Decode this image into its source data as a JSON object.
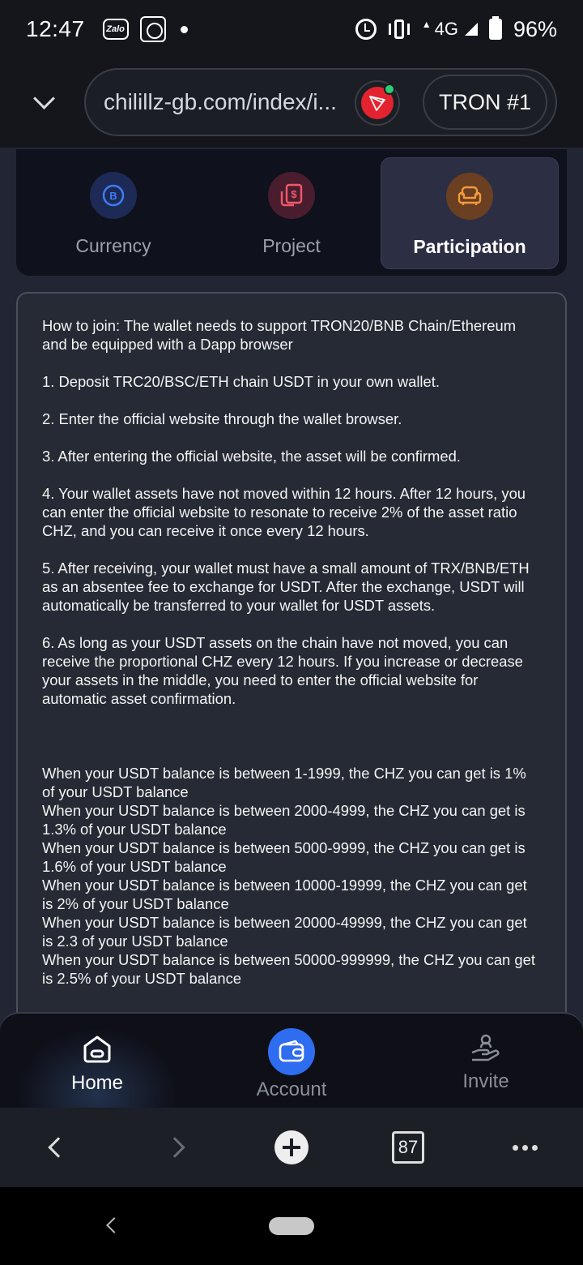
{
  "status_bar": {
    "time": "12:47",
    "app_icons": [
      "zalo-icon",
      "app-notification-icon"
    ],
    "zalo_label": "Zalo",
    "network": "4G",
    "battery": "96%"
  },
  "browser": {
    "url": "chilillz-gb.com/index/i...",
    "network_button": "TRON #1",
    "tab_count": "87"
  },
  "tabs": [
    {
      "label": "Currency",
      "icon": "bitcoin-icon",
      "active": false
    },
    {
      "label": "Project",
      "icon": "dollar-doc-icon",
      "active": false
    },
    {
      "label": "Participation",
      "icon": "sofa-icon",
      "active": true
    }
  ],
  "info": {
    "intro": "How to join: The wallet needs to support TRON20/BNB Chain/Ethereum and be equipped with a Dapp browser",
    "steps": [
      "1. Deposit TRC20/BSC/ETH chain USDT in your own wallet.",
      "2. Enter the official website through the wallet browser.",
      "3. After entering the official website, the asset will be confirmed.",
      "4. Your wallet assets have not moved within 12 hours. After 12 hours, you can enter the official website to resonate to receive 2% of the asset ratio CHZ, and you can receive it once every 12 hours.",
      "5. After receiving, your wallet must have a small amount of TRX/BNB/ETH as an absentee fee to exchange for USDT. After the exchange, USDT will automatically be transferred to your wallet for USDT assets.",
      "6. As long as your USDT assets on the chain have not moved, you can receive the proportional CHZ every 12 hours. If you increase or decrease your assets in the middle, you need to enter the official website for automatic asset confirmation."
    ],
    "tiers": [
      "When your USDT balance is between 1-1999, the CHZ you can get is 1% of your USDT balance",
      "When your USDT balance is between 2000-4999, the CHZ you can get is 1.3% of your USDT balance",
      "When your USDT balance is between 5000-9999, the CHZ you can get is 1.6% of your USDT balance",
      "When your USDT balance is between 10000-19999, the CHZ you can get is 2% of your USDT balance",
      "When your USDT balance is between 20000-49999, the CHZ you can get is 2.3 of your USDT balance",
      "When your USDT balance is between 50000-999999, the CHZ you can get is 2.5% of your USDT balance"
    ]
  },
  "bottom_nav": [
    {
      "label": "Home",
      "icon": "home-icon",
      "active": true
    },
    {
      "label": "Account",
      "icon": "wallet-icon",
      "active": false
    },
    {
      "label": "Invite",
      "icon": "invite-icon",
      "active": false
    }
  ],
  "colors": {
    "page_bg": "#222634",
    "tab_card_bg": "#0f111c",
    "active_tab_bg": "#2c2f44",
    "accent_blue": "#2f6df0",
    "tron_red": "#e3232f"
  }
}
